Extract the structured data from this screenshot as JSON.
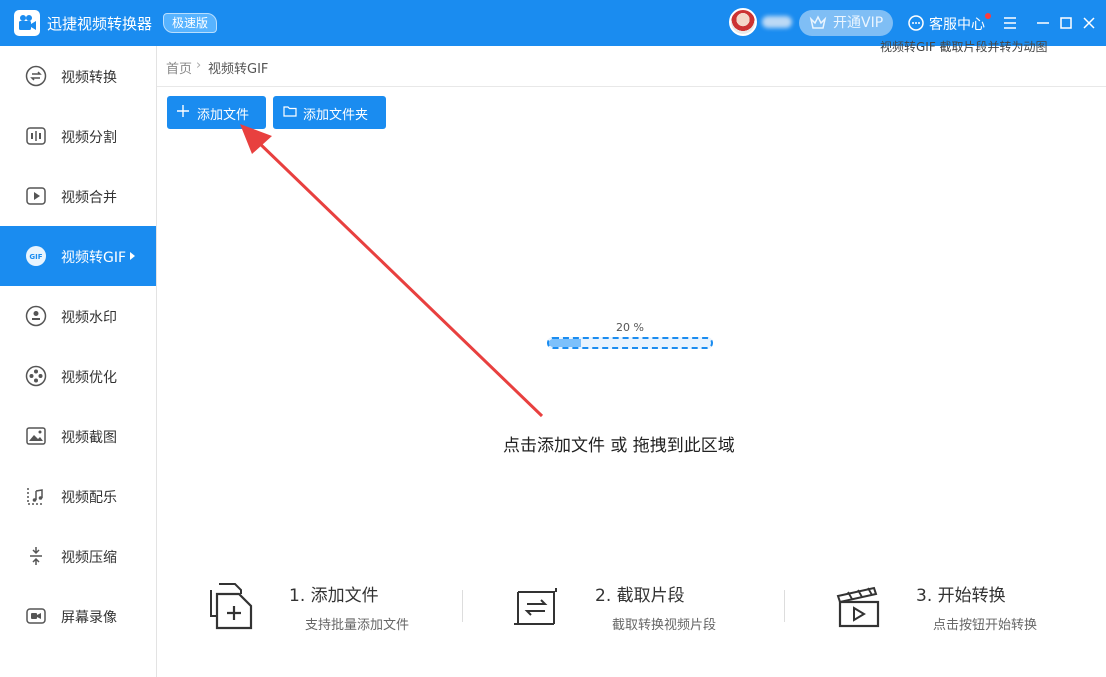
{
  "app": {
    "title": "迅捷视频转换器",
    "badge": "极速版"
  },
  "header": {
    "vip_label": "开通VIP",
    "service_label": "客服中心",
    "tooltip_cut": "视频转GIF 截取片段并转为动图"
  },
  "sidebar": {
    "items": [
      {
        "label": "视频转换",
        "icon": "convert-icon"
      },
      {
        "label": "视频分割",
        "icon": "split-icon"
      },
      {
        "label": "视频合并",
        "icon": "merge-icon"
      },
      {
        "label": "视频转GIF",
        "icon": "gif-icon",
        "active": true
      },
      {
        "label": "视频水印",
        "icon": "watermark-icon"
      },
      {
        "label": "视频优化",
        "icon": "optimize-icon"
      },
      {
        "label": "视频截图",
        "icon": "screenshot-icon"
      },
      {
        "label": "视频配乐",
        "icon": "music-icon"
      },
      {
        "label": "视频压缩",
        "icon": "compress-icon"
      },
      {
        "label": "屏幕录像",
        "icon": "record-icon"
      }
    ]
  },
  "breadcrumb": {
    "home": "首页",
    "separator": "›",
    "current": "视频转GIF"
  },
  "toolbar": {
    "add_file": "添加文件",
    "add_folder": "添加文件夹"
  },
  "progress": {
    "text": "20 %",
    "value": 0.2
  },
  "main": {
    "drop_hint": "点击添加文件 或 拖拽到此区域"
  },
  "steps": [
    {
      "title": "1. 添加文件",
      "desc": "支持批量添加文件"
    },
    {
      "title": "2. 截取片段",
      "desc": "截取转换视频片段"
    },
    {
      "title": "3. 开始转换",
      "desc": "点击按钮开始转换"
    }
  ],
  "colors": {
    "primary": "#1a8cf0",
    "arrow": "#e8403f"
  }
}
